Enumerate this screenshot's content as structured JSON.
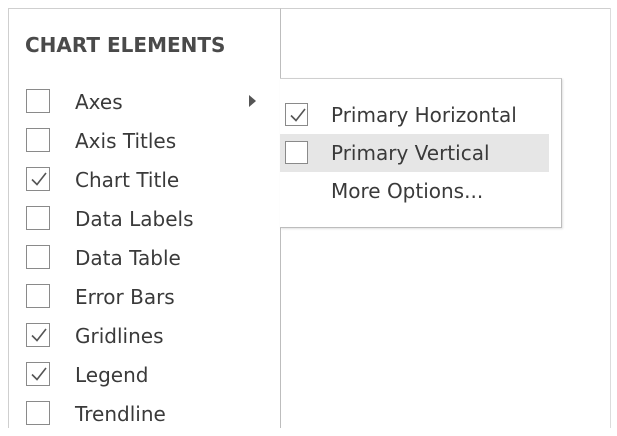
{
  "panel": {
    "title": "CHART ELEMENTS",
    "items": [
      {
        "label": "Axes",
        "checked": false,
        "has_submenu": true
      },
      {
        "label": "Axis Titles",
        "checked": false,
        "has_submenu": false
      },
      {
        "label": "Chart Title",
        "checked": true,
        "has_submenu": false
      },
      {
        "label": "Data Labels",
        "checked": false,
        "has_submenu": false
      },
      {
        "label": "Data Table",
        "checked": false,
        "has_submenu": false
      },
      {
        "label": "Error Bars",
        "checked": false,
        "has_submenu": false
      },
      {
        "label": "Gridlines",
        "checked": true,
        "has_submenu": false
      },
      {
        "label": "Legend",
        "checked": true,
        "has_submenu": false
      },
      {
        "label": "Trendline",
        "checked": false,
        "has_submenu": false
      }
    ]
  },
  "submenu": {
    "items": [
      {
        "label": "Primary Horizontal",
        "checked": true,
        "has_checkbox": true,
        "highlighted": false
      },
      {
        "label": "Primary Vertical",
        "checked": false,
        "has_checkbox": true,
        "highlighted": true
      },
      {
        "label": "More Options...",
        "checked": false,
        "has_checkbox": false,
        "highlighted": false
      }
    ]
  },
  "icons": {
    "check": "check-icon",
    "submenu_arrow": "submenu-arrow-icon"
  },
  "colors": {
    "highlight": "#e6e6e6",
    "text": "#3a3a3a",
    "checkbox_border": "#8a8a8a"
  }
}
